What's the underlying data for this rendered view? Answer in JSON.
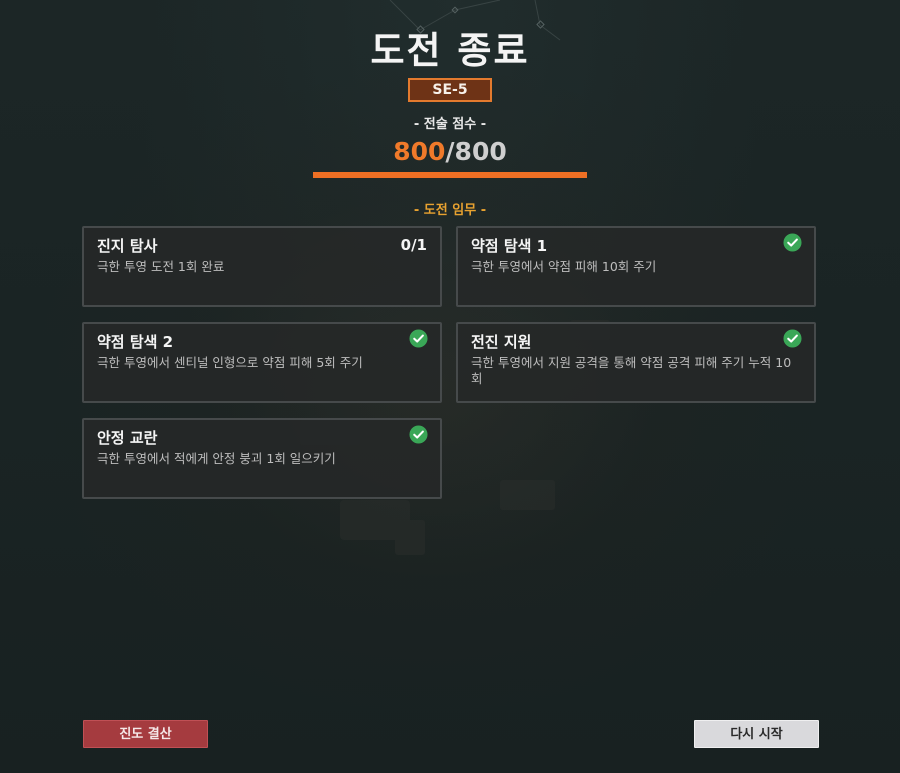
{
  "header": {
    "title": "도전 종료",
    "stage_code": "SE-5"
  },
  "score": {
    "label": "- 전술 점수 -",
    "current": "800",
    "max": "/800",
    "fill_ratio": 1.0
  },
  "tasks_label": "- 도전 임무 -",
  "tasks": [
    {
      "title": "진지 탐사",
      "desc": "극한 투영 도전 1회 완료",
      "progress": "0/1",
      "completed": false
    },
    {
      "title": "약점 탐색 1",
      "desc": "극한 투영에서 약점 피해 10회 주기",
      "progress": "",
      "completed": true
    },
    {
      "title": "약점 탐색 2",
      "desc": "극한 투영에서 센티널 인형으로 약점 피해 5회 주기",
      "progress": "",
      "completed": true
    },
    {
      "title": "전진 지원",
      "desc": "극한 투영에서 지원 공격을 통해 약점 공격 피해 주기 누적 10회",
      "progress": "",
      "completed": true
    },
    {
      "title": "안정 교란",
      "desc": "극한 투영에서 적에게 안정 붕괴 1회 일으키기",
      "progress": "",
      "completed": true
    }
  ],
  "buttons": {
    "settle": "진도 결산",
    "restart": "다시 시작"
  },
  "colors": {
    "accent_orange": "#ee6f24",
    "task_label_gold": "#e8a230",
    "check_green": "#3aa757",
    "settle_red": "#a53b3f"
  },
  "icons": {
    "completed": "check-circle-icon"
  }
}
